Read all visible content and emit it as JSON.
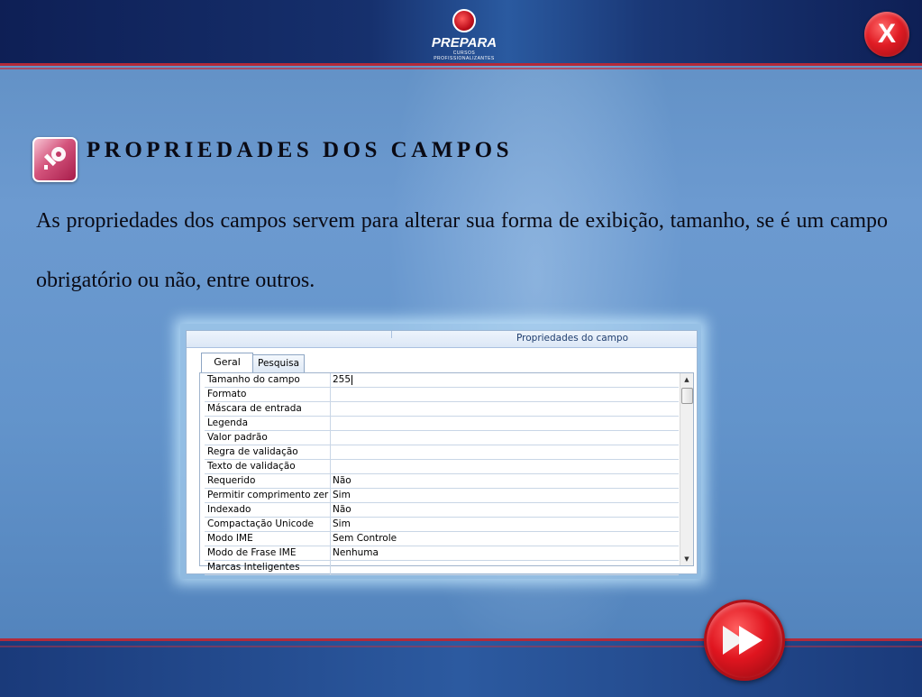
{
  "header": {
    "logo_text": "PREPARA",
    "logo_subtitle": "CURSOS PROFISSIONALIZANTES",
    "close_label": "X"
  },
  "content": {
    "title": "PROPRIEDADES DOS CAMPOS",
    "paragraph": "As propriedades dos campos servem para alterar sua forma de exibição, tamanho, se é um campo obrigatório ou não, entre outros."
  },
  "panel": {
    "title": "Propriedades do campo",
    "tabs": [
      {
        "label": "Geral"
      },
      {
        "label": "Pesquisa"
      }
    ],
    "rows": [
      {
        "name": "Tamanho do campo",
        "value": "255"
      },
      {
        "name": "Formato",
        "value": ""
      },
      {
        "name": "Máscara de entrada",
        "value": ""
      },
      {
        "name": "Legenda",
        "value": ""
      },
      {
        "name": "Valor padrão",
        "value": ""
      },
      {
        "name": "Regra de validação",
        "value": ""
      },
      {
        "name": "Texto de validação",
        "value": ""
      },
      {
        "name": "Requerido",
        "value": "Não"
      },
      {
        "name": "Permitir comprimento zer",
        "value": "Sim"
      },
      {
        "name": "Indexado",
        "value": "Não"
      },
      {
        "name": "Compactação Unicode",
        "value": "Sim"
      },
      {
        "name": "Modo IME",
        "value": "Sem Controle"
      },
      {
        "name": "Modo de Frase IME",
        "value": "Nenhuma"
      },
      {
        "name": "Marcas Inteligentes",
        "value": ""
      }
    ]
  },
  "icons": {
    "close": "close-icon",
    "next": "next-arrow-icon",
    "access": "access-key-icon",
    "scroll_up": "scroll-up-icon",
    "scroll_down": "scroll-down-icon"
  },
  "colors": {
    "accent_red": "#e01c24",
    "header_navy": "#0e1f55",
    "background_blue": "#6394cb",
    "stripe_red": "#b22a3a"
  }
}
